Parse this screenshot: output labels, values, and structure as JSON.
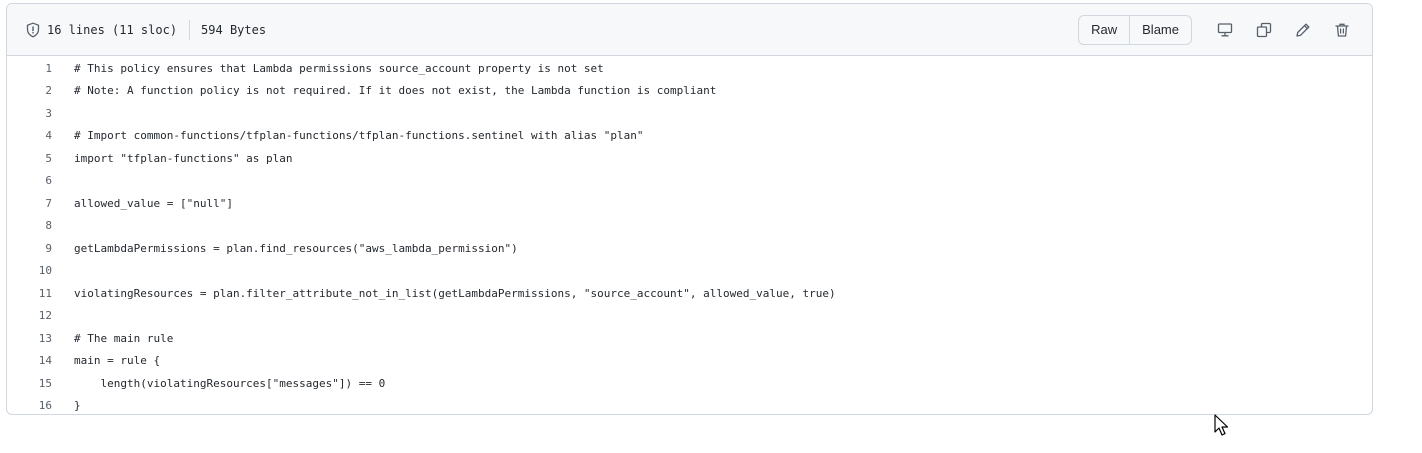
{
  "file_info": {
    "lines_label": "16 lines (11 sloc)",
    "size_label": "594 Bytes"
  },
  "toolbar": {
    "raw_label": "Raw",
    "blame_label": "Blame",
    "icons": [
      "display-icon",
      "copy-icon",
      "pencil-icon",
      "trash-icon"
    ]
  },
  "code": {
    "lines": [
      {
        "n": "1",
        "text": "# This policy ensures that Lambda permissions source_account property is not set"
      },
      {
        "n": "2",
        "text": "# Note: A function policy is not required. If it does not exist, the Lambda function is compliant"
      },
      {
        "n": "3",
        "text": ""
      },
      {
        "n": "4",
        "text": "# Import common-functions/tfplan-functions/tfplan-functions.sentinel with alias \"plan\""
      },
      {
        "n": "5",
        "text": "import \"tfplan-functions\" as plan"
      },
      {
        "n": "6",
        "text": ""
      },
      {
        "n": "7",
        "text": "allowed_value = [\"null\"]"
      },
      {
        "n": "8",
        "text": ""
      },
      {
        "n": "9",
        "text": "getLambdaPermissions = plan.find_resources(\"aws_lambda_permission\")"
      },
      {
        "n": "10",
        "text": ""
      },
      {
        "n": "11",
        "text": "violatingResources = plan.filter_attribute_not_in_list(getLambdaPermissions, \"source_account\", allowed_value, true)"
      },
      {
        "n": "12",
        "text": ""
      },
      {
        "n": "13",
        "text": "# The main rule"
      },
      {
        "n": "14",
        "text": "main = rule {"
      },
      {
        "n": "15",
        "text": "    length(violatingResources[\"messages\"]) == 0"
      },
      {
        "n": "16",
        "text": "}"
      }
    ]
  },
  "colors": {
    "border": "#d0d7de",
    "header_bg": "#f6f8fa",
    "text": "#24292f",
    "line_number": "#57606a"
  }
}
